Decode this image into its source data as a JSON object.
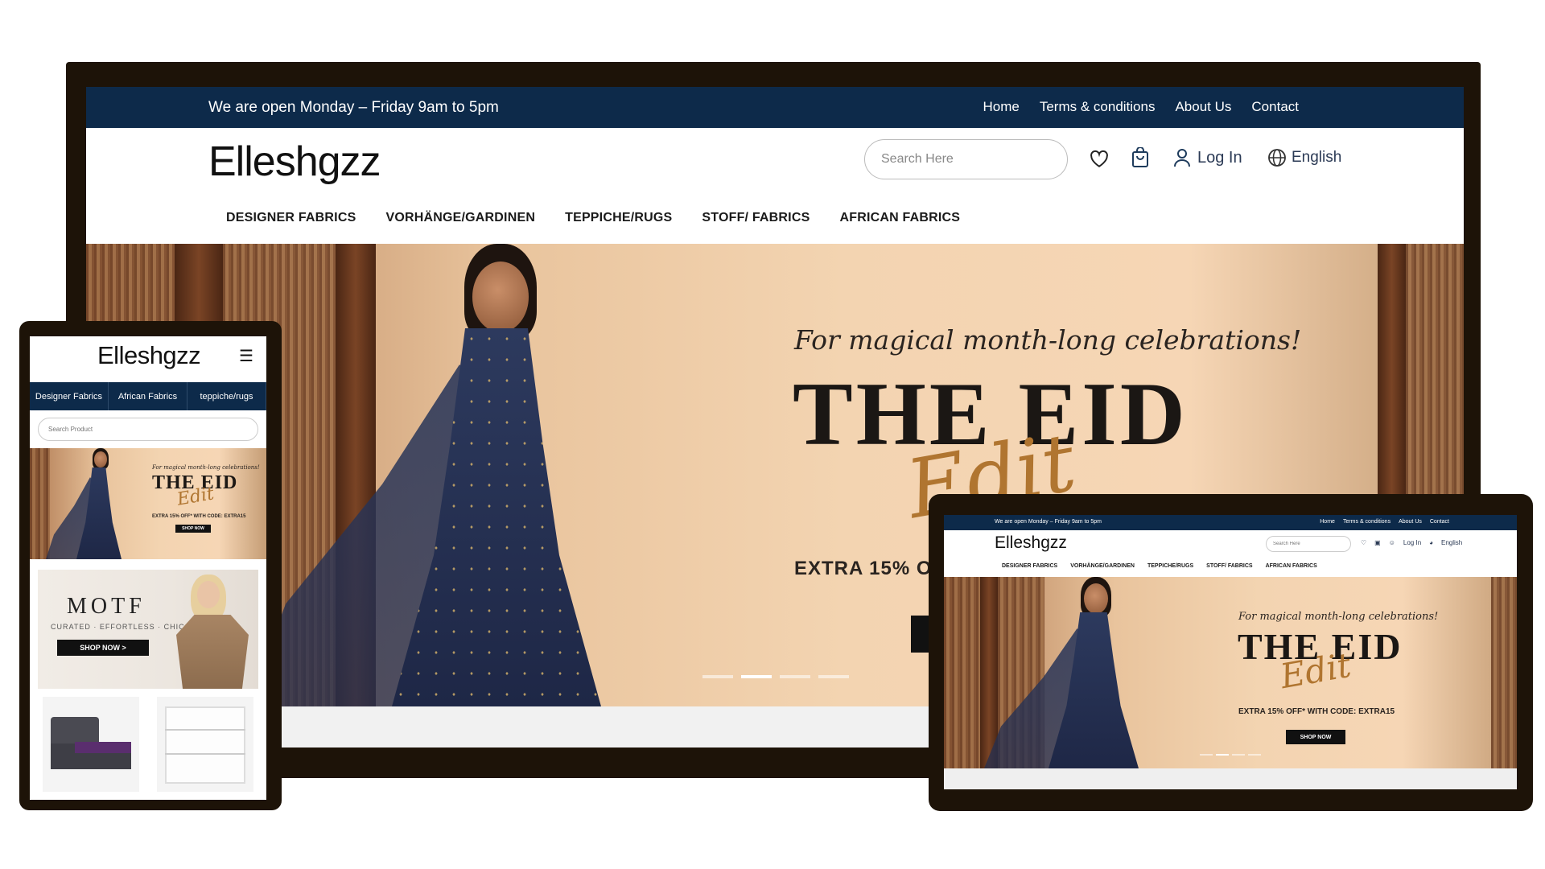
{
  "topbar": {
    "open_hours": "We are open Monday – Friday 9am to 5pm",
    "links": [
      "Home",
      "Terms & conditions",
      "About Us",
      "Contact"
    ]
  },
  "brand": {
    "logo": "Elleshgzz"
  },
  "header": {
    "search_placeholder": "Search Here",
    "login_label": "Log In",
    "language_label": "English",
    "icons": [
      "heart-icon",
      "shopping-bag-icon",
      "user-icon",
      "globe-icon"
    ]
  },
  "nav": {
    "items": [
      "DESIGNER FABRICS",
      "VORHÄNGE/GARDINEN",
      "TEPPICHE/RUGS",
      "STOFF/ FABRICS",
      "AFRICAN FABRICS"
    ]
  },
  "hero": {
    "tagline": "For magical month-long celebrations!",
    "title": "THE EID",
    "script": "Edit",
    "offer": "EXTRA 15% OFF* WITH CODE: EXTRA15",
    "offer_partial": "EXTRA 15% OF",
    "cta": "SHOP NOW",
    "slides_total": 4,
    "active_slide": 2
  },
  "mobile": {
    "tabs": [
      "Designer Fabrics",
      "African Fabrics",
      "teppiche/rugs"
    ],
    "search_placeholder": "Search Product",
    "promo": {
      "brand": "MOTF",
      "subtitle": "CURATED · EFFORTLESS · CHIC",
      "cta": "SHOP NOW >"
    }
  },
  "colors": {
    "navy": "#0d2a4a",
    "device_frame": "#1d1308",
    "hero_peach": "#f3d4b1",
    "script_gold": "#b07530"
  }
}
